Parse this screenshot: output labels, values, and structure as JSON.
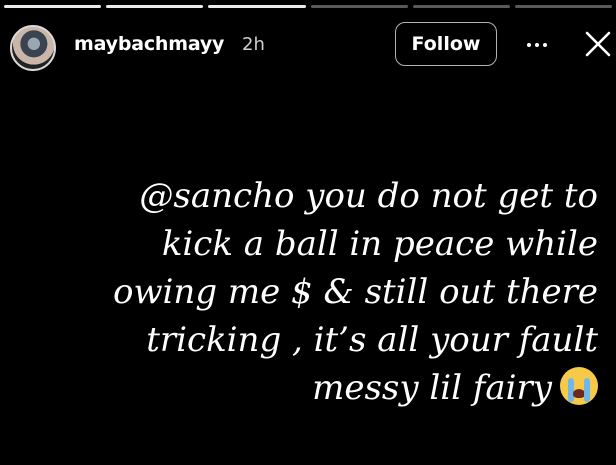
{
  "story": {
    "progress_segments": [
      {
        "done": true
      },
      {
        "done": true
      },
      {
        "done": true
      },
      {
        "done": false
      },
      {
        "done": false
      },
      {
        "done": false
      }
    ],
    "username": "maybachmayy",
    "time_ago": "2h",
    "follow_label": "Follow",
    "caption_lines": [
      "@sancho you do not get to",
      "kick a ball in peace while",
      "owing me $ & still out there",
      "tricking , it’s all your fault",
      "messy lil fairy"
    ],
    "emoji": "loudly-crying-face-icon"
  }
}
